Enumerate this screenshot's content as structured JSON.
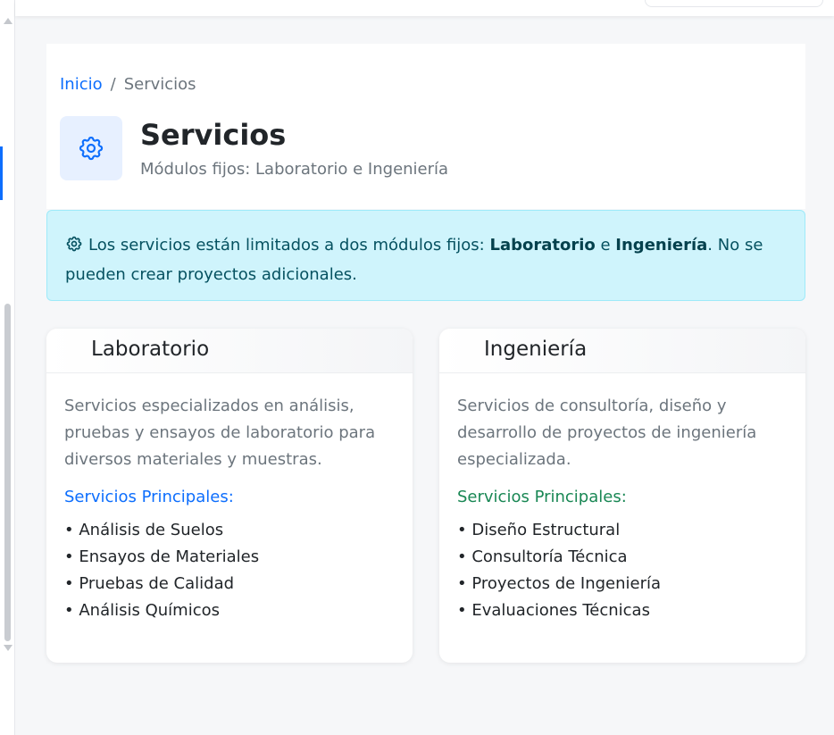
{
  "breadcrumb": {
    "home": "Inicio",
    "separator": "/",
    "current": "Servicios"
  },
  "header": {
    "icon": "gear-icon",
    "title": "Servicios",
    "subtitle": "Módulos fijos: Laboratorio e Ingeniería"
  },
  "alert": {
    "icon": "gear-icon",
    "text_before": "Los servicios están limitados a dos módulos fijos: ",
    "bold_1": "Laboratorio",
    "text_middle": " e ",
    "bold_2": "Ingeniería",
    "text_after": ". No se pueden crear proyectos adicionales."
  },
  "cards": [
    {
      "title": "Laboratorio",
      "description": "Servicios especializados en análisis, pruebas y ensayos de laboratorio para diversos materiales y muestras.",
      "subheading": "Servicios Principales:",
      "items": [
        "Análisis de Suelos",
        "Ensayos de Materiales",
        "Pruebas de Calidad",
        "Análisis Químicos"
      ]
    },
    {
      "title": "Ingeniería",
      "description": "Servicios de consultoría, diseño y desarrollo de proyectos de ingeniería especializada.",
      "subheading": "Servicios Principales:",
      "items": [
        "Diseño Estructural",
        "Consultoría Técnica",
        "Proyectos de Ingeniería",
        "Evaluaciones Técnicas"
      ]
    }
  ],
  "colors": {
    "primary": "#0d6efd",
    "success": "#198754",
    "info_bg": "#cff4fc",
    "info_text": "#055160"
  }
}
